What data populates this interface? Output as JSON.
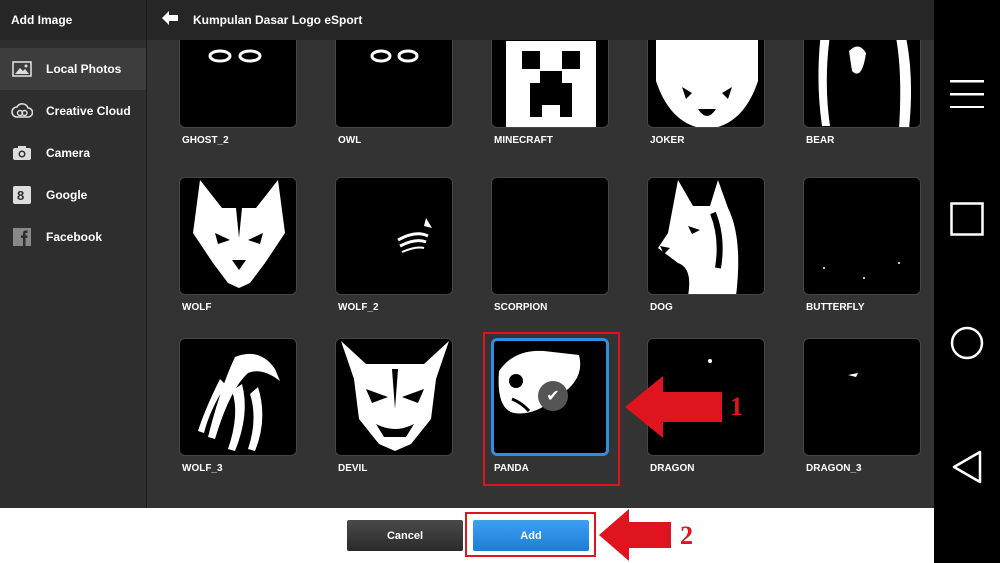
{
  "sidebar": {
    "title": "Add Image",
    "items": [
      {
        "label": "Local Photos",
        "icon": "photo-icon",
        "active": true
      },
      {
        "label": "Creative Cloud",
        "icon": "creative-cloud-icon",
        "active": false
      },
      {
        "label": "Camera",
        "icon": "camera-icon",
        "active": false
      },
      {
        "label": "Google",
        "icon": "google-icon",
        "active": false
      },
      {
        "label": "Facebook",
        "icon": "facebook-icon",
        "active": false
      }
    ]
  },
  "header": {
    "back_icon": "back-arrow-icon",
    "title": "Kumpulan Dasar Logo eSport"
  },
  "grid": {
    "items": [
      {
        "label": "GHOST_2"
      },
      {
        "label": "OWL"
      },
      {
        "label": "MINECRAFT"
      },
      {
        "label": "JOKER"
      },
      {
        "label": "BEAR"
      },
      {
        "label": "WOLF"
      },
      {
        "label": "WOLF_2"
      },
      {
        "label": "SCORPION"
      },
      {
        "label": "DOG"
      },
      {
        "label": "BUTTERFLY"
      },
      {
        "label": "WOLF_3"
      },
      {
        "label": "DEVIL"
      },
      {
        "label": "PANDA",
        "selected": true
      },
      {
        "label": "DRAGON"
      },
      {
        "label": "DRAGON_3"
      }
    ]
  },
  "buttons": {
    "cancel_label": "Cancel",
    "add_label": "Add"
  },
  "annotations": {
    "label_1": "1",
    "label_2": "2",
    "color": "#e0141e"
  },
  "navbar": {
    "icons": [
      "menu-icon",
      "recent-apps-icon",
      "home-icon",
      "back-icon"
    ]
  },
  "colors": {
    "accent": "#2d8ee6",
    "annotation": "#e0141e"
  }
}
